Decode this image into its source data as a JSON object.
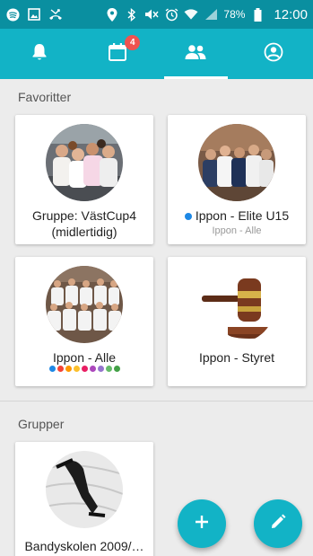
{
  "statusbar": {
    "battery": "78%",
    "time": "12:00",
    "icons": [
      "spotify-icon",
      "image-icon",
      "missed-call-icon",
      "location-icon",
      "bluetooth-icon",
      "mute-icon",
      "alarm-icon",
      "wifi-icon",
      "signal-icon",
      "battery-icon"
    ]
  },
  "tabs": [
    {
      "name": "notifications",
      "icon": "bell-icon"
    },
    {
      "name": "calendar",
      "icon": "calendar-icon",
      "badge": "4"
    },
    {
      "name": "groups",
      "icon": "people-icon",
      "active": true
    },
    {
      "name": "profile",
      "icon": "account-icon"
    }
  ],
  "favorites": {
    "title": "Favoritter",
    "cards": [
      {
        "title": "Gruppe: VästCup4 (midlertidig)",
        "sub": ""
      },
      {
        "title": "Ippon - Elite U15",
        "sub": "Ippon - Alle",
        "dot_color": "#1e88e5"
      },
      {
        "title": "Ippon - Alle",
        "sub": "",
        "dot_colors": [
          "#1e88e5",
          "#f44336",
          "#ff9800",
          "#fbc02d",
          "#e91e63",
          "#ab47bc",
          "#9575cd",
          "#66bb6a",
          "#43a047"
        ]
      },
      {
        "title": "Ippon - Styret",
        "sub": ""
      }
    ]
  },
  "groups": {
    "title": "Grupper",
    "cards": [
      {
        "title": "Bandyskolen 2009/…"
      }
    ]
  },
  "colors": {
    "primary": "#12b3c6",
    "statusbar": "#0a8fa0",
    "badge": "#ef5350"
  }
}
